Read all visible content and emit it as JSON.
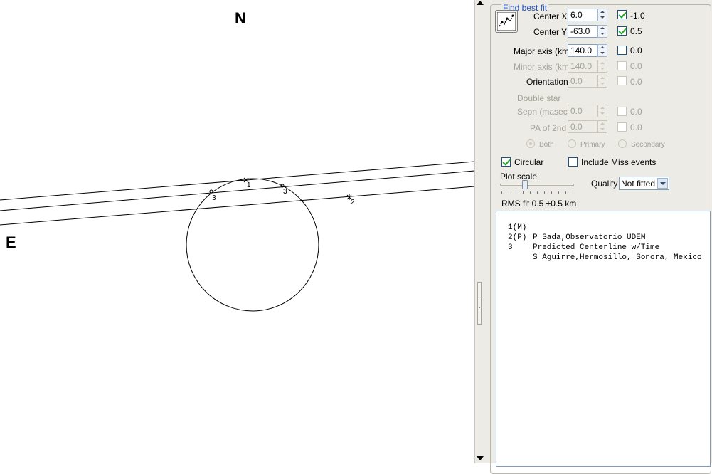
{
  "plot": {
    "north_label": "N",
    "east_label": "E",
    "chord_labels": {
      "c1": "1",
      "c2": "2",
      "c3a": "3",
      "c3b": "3"
    }
  },
  "panel": {
    "group_title": "Find best fit",
    "fit_icon": "fit-ellipse-icon",
    "center_x": {
      "label": "Center X",
      "value": "6.0",
      "check_value": "-1.0",
      "checked": true,
      "enabled": true
    },
    "center_y": {
      "label": "Center Y",
      "value": "-63.0",
      "check_value": "0.5",
      "checked": true,
      "enabled": true
    },
    "major_axis": {
      "label": "Major axis (km)",
      "value": "140.0",
      "check_value": "0.0",
      "checked": false,
      "enabled": true
    },
    "minor_axis": {
      "label": "Minor axis (km)",
      "value": "140.0",
      "check_value": "0.0",
      "checked": false,
      "enabled": false
    },
    "orientation": {
      "label": "Orientation",
      "value": "0.0",
      "check_value": "0.0",
      "checked": false,
      "enabled": false
    },
    "double_star_label": "Double star",
    "sepn": {
      "label": "Sepn (masec)",
      "value": "0.0",
      "check_value": "0.0",
      "checked": false,
      "enabled": false
    },
    "pa_2nd": {
      "label": "PA of 2nd",
      "value": "0.0",
      "check_value": "0.0",
      "checked": false,
      "enabled": false
    },
    "radio": {
      "both": "Both",
      "primary": "Primary",
      "secondary": "Secondary",
      "selected": "both"
    },
    "circular": {
      "label": "Circular",
      "checked": true
    },
    "include_miss": {
      "label": "Include Miss events",
      "checked": false
    },
    "plot_scale_label": "Plot scale",
    "plot_scale_level": 0.33,
    "quality_label": "Quality",
    "quality_value": "Not fitted",
    "rms_fit": "RMS fit 0.5 ±0.5 km",
    "observers": [
      {
        "num": "1(M)",
        "name": "P Sada,Observatorio UDEM"
      },
      {
        "num": "2(P)",
        "name": "Predicted Centerline w/Time"
      },
      {
        "num": "3",
        "name": "S Aguirre,Hermosillo, Sonora, Mexico"
      }
    ]
  },
  "colors": {
    "panel_bg": "#ecebe6",
    "group_title": "#1f4fbf",
    "check_mark": "#21a121",
    "field_border": "#7f9db9",
    "disabled_text": "#a4a399"
  }
}
